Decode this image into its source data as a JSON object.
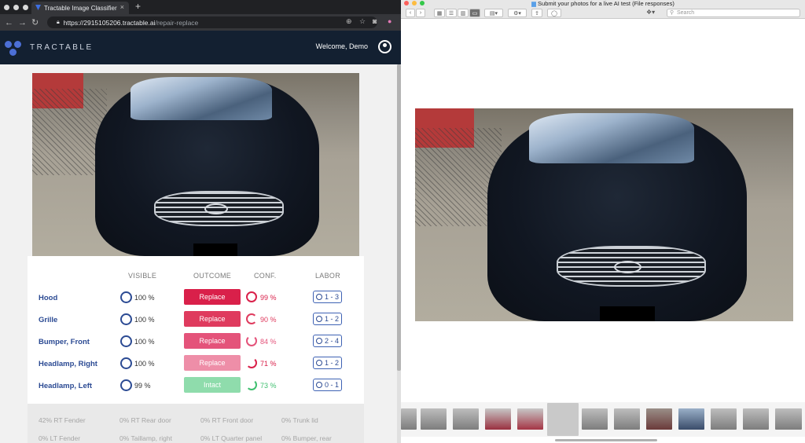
{
  "browser": {
    "tab_title": "Tractable Image Classifier",
    "url_main": "https://2915105206.tractable.ai",
    "url_path": "/repair-replace"
  },
  "app": {
    "brand": "TRACTABLE",
    "welcome": "Welcome, Demo"
  },
  "columns": {
    "visible": "VISIBLE",
    "outcome": "OUTCOME",
    "conf": "CONF.",
    "labor": "LABOR"
  },
  "rows": [
    {
      "part": "Hood",
      "visible": "100 %",
      "outcome": "Replace",
      "conf": "99 %",
      "labor": "1 - 3",
      "outcome_color": "#d9204a",
      "conf_color": "#d9204a"
    },
    {
      "part": "Grille",
      "visible": "100 %",
      "outcome": "Replace",
      "conf": "90 %",
      "labor": "1 - 2",
      "outcome_color": "#df3b5e",
      "conf_color": "#df3b5e"
    },
    {
      "part": "Bumper, Front",
      "visible": "100 %",
      "outcome": "Replace",
      "conf": "84 %",
      "labor": "2 - 4",
      "outcome_color": "#e4537a",
      "conf_color": "#e4537a"
    },
    {
      "part": "Headlamp, Right",
      "visible": "100 %",
      "outcome": "Replace",
      "conf": "71 %",
      "labor": "1 - 2",
      "outcome_color": "#ee8ea8",
      "conf_color": "#d9204a"
    },
    {
      "part": "Headlamp, Left",
      "visible": "99 %",
      "outcome": "Intact",
      "conf": "73 %",
      "labor": "0 - 1",
      "outcome_color": "#8fdcac",
      "conf_color": "#3fbf6f"
    }
  ],
  "other_parts": [
    "42% RT Fender",
    "0% RT Rear door",
    "0% RT Front door",
    "0% Trunk lid",
    "0% LT Fender",
    "0% Taillamp, right",
    "0% LT Quarter panel",
    "0% Bumper, rear"
  ],
  "viewer": {
    "title": "Submit your photos for a live AI test (File responses)",
    "search_placeholder": "Search"
  }
}
